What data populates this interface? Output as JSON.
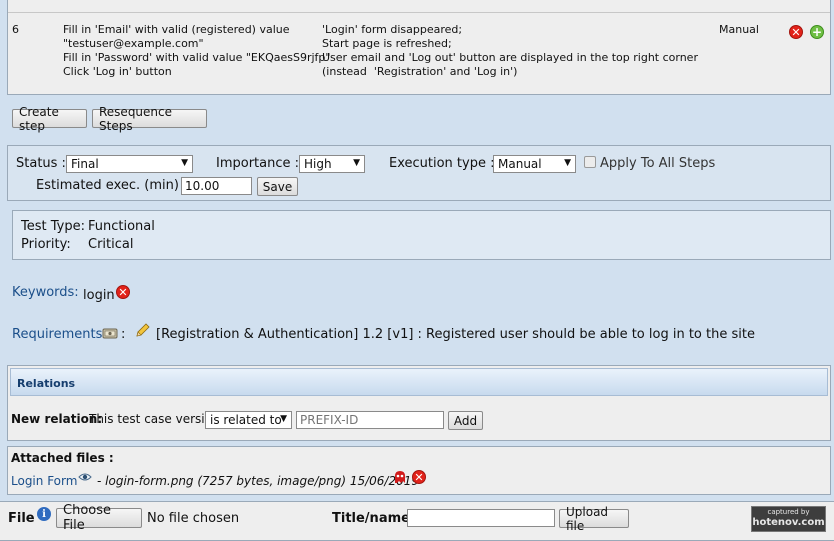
{
  "step": {
    "number": "6",
    "actions": "Fill in 'Email' with valid (registered) value\n\"testuser@example.com\"\nFill in 'Password' with valid value \"EKQaesS9rjfp\"\nClick 'Log in' button",
    "expected": "'Login' form disappeared;\nStart page is refreshed;\nUser email and 'Log out' button are displayed in the top right corner\n(instead  'Registration' and 'Log in')",
    "execution": "Manual"
  },
  "step_buttons": {
    "create": "Create step",
    "resequence": "Resequence Steps"
  },
  "exec_panel": {
    "status_label": "Status :",
    "status_value": "Final",
    "importance_label": "Importance :",
    "importance_value": "High",
    "exec_type_label": "Execution type :",
    "exec_type_value": "Manual",
    "apply_all_label": "Apply To All Steps",
    "estimated_label": "Estimated exec. (min) :",
    "estimated_value": "10.00",
    "save_label": "Save"
  },
  "info": {
    "test_type_label": "Test Type:",
    "test_type_value": "Functional",
    "priority_label": "Priority:",
    "priority_value": "Critical"
  },
  "keywords": {
    "label": "Keywords:",
    "value": "login"
  },
  "requirements": {
    "label": "Requirements",
    "separator": ":",
    "value": "[Registration & Authentication] 1.2 [v1] : Registered user should be able to log in to the site"
  },
  "relations": {
    "title": "Relations",
    "new_relation_label": "New relation:",
    "this_version_label": "This test case version",
    "relation_type": "is related to",
    "prefix_placeholder": "PREFIX-ID",
    "add_label": "Add"
  },
  "attachments": {
    "title": "Attached files :",
    "file_link": "Login Form",
    "file_details": "- login-form.png (7257 bytes, image/png) 15/06/2019"
  },
  "upload": {
    "file_label": "File",
    "choose_label": "Choose File",
    "no_file": "No file chosen",
    "title_label": "Title/name:",
    "upload_label": "Upload file"
  },
  "watermark": {
    "line1": "captured by",
    "line2": "hotenov.com"
  }
}
